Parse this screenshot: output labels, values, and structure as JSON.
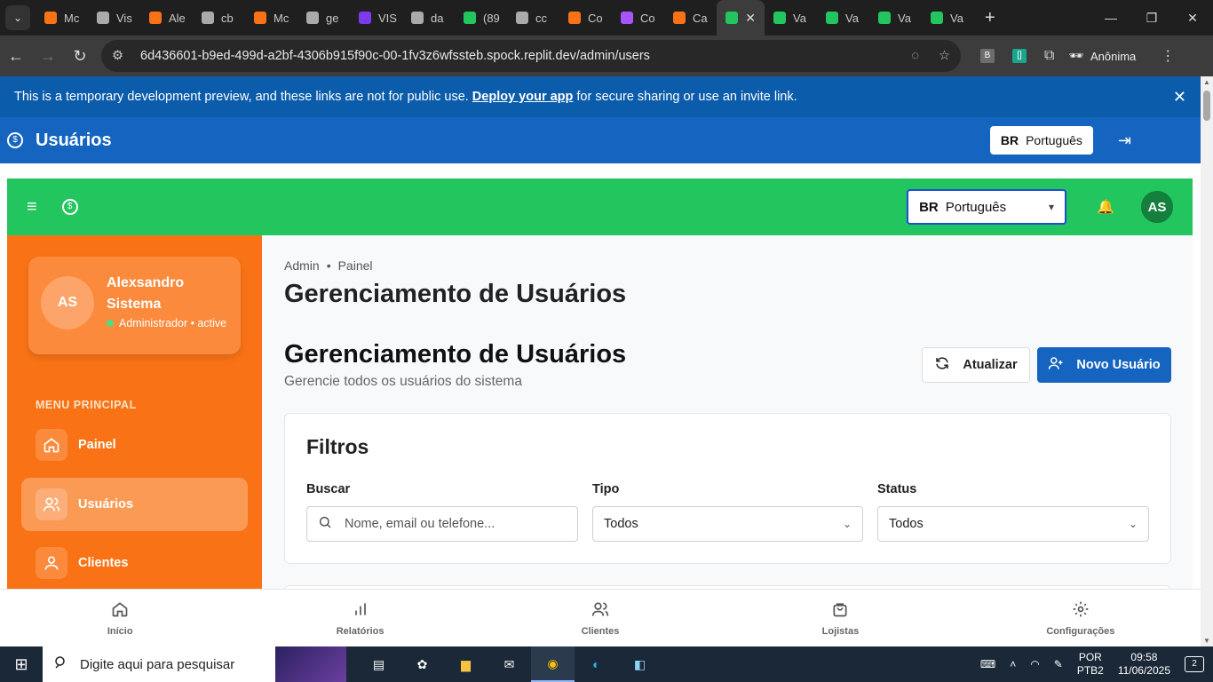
{
  "browser": {
    "tabs": [
      {
        "label": "Mc",
        "color": "#f97316"
      },
      {
        "label": "Vis",
        "color": "#aaaaaa"
      },
      {
        "label": "Ale",
        "color": "#f97316"
      },
      {
        "label": "cb",
        "color": "#aaaaaa"
      },
      {
        "label": "Mc",
        "color": "#f97316"
      },
      {
        "label": "ge",
        "color": "#aaaaaa"
      },
      {
        "label": "VIS",
        "color": "#7c3aed"
      },
      {
        "label": "da",
        "color": "#aaaaaa"
      },
      {
        "label": "(89",
        "color": "#22c55e"
      },
      {
        "label": "cc",
        "color": "#aaaaaa"
      },
      {
        "label": "Co",
        "color": "#f97316"
      },
      {
        "label": "Co",
        "color": "#a855f7"
      },
      {
        "label": "Ca",
        "color": "#f97316"
      },
      {
        "label": "",
        "color": "#22c55e",
        "active": true
      },
      {
        "label": "Va",
        "color": "#22c55e"
      },
      {
        "label": "Va",
        "color": "#22c55e"
      },
      {
        "label": "Va",
        "color": "#22c55e"
      },
      {
        "label": "Va",
        "color": "#22c55e"
      }
    ],
    "url": "6d436601-b9ed-499d-a2bf-4306b915f90c-00-1fv3z6wfssteb.spock.replit.dev/admin/users",
    "profile_label": "Anônima"
  },
  "dev_banner": {
    "text_before": "This is a temporary development preview, and these links are not for public use.",
    "link": "Deploy your app",
    "text_after": "for secure sharing or use an invite link."
  },
  "app_header": {
    "title": "Usuários",
    "lang_code": "BR",
    "lang_label": "Português"
  },
  "topbar": {
    "lang_code": "BR",
    "lang_label": "Português",
    "avatar": "AS"
  },
  "sidebar": {
    "user": {
      "initials": "AS",
      "name": "Alexsandro Sistema",
      "role": "Administrador • active"
    },
    "menu_header": "MENU PRINCIPAL",
    "items": [
      {
        "label": "Painel"
      },
      {
        "label": "Usuários"
      },
      {
        "label": "Clientes"
      }
    ]
  },
  "main": {
    "breadcrumb": [
      "Admin",
      "Painel"
    ],
    "page_title": "Gerenciamento de Usuários",
    "section_title": "Gerenciamento de Usuários",
    "subtitle": "Gerencie todos os usuários do sistema",
    "refresh_label": "Atualizar",
    "new_user_label": "Novo Usuário",
    "filters": {
      "title": "Filtros",
      "search_label": "Buscar",
      "search_placeholder": "Nome, email ou telefone...",
      "type_label": "Tipo",
      "type_value": "Todos",
      "status_label": "Status",
      "status_value": "Todos"
    }
  },
  "bottom_nav": [
    {
      "label": "Início"
    },
    {
      "label": "Relatórios"
    },
    {
      "label": "Clientes"
    },
    {
      "label": "Lojistas"
    },
    {
      "label": "Configurações"
    }
  ],
  "taskbar": {
    "search_placeholder": "Digite aqui para pesquisar",
    "lang_top": "POR",
    "lang_bottom": "PTB2",
    "time": "09:58",
    "date": "11/06/2025",
    "notifications": "2"
  },
  "colors": {
    "banner_blue": "#0b5cab",
    "header_blue": "#1565c0",
    "green": "#22c55e",
    "orange": "#f97316"
  }
}
